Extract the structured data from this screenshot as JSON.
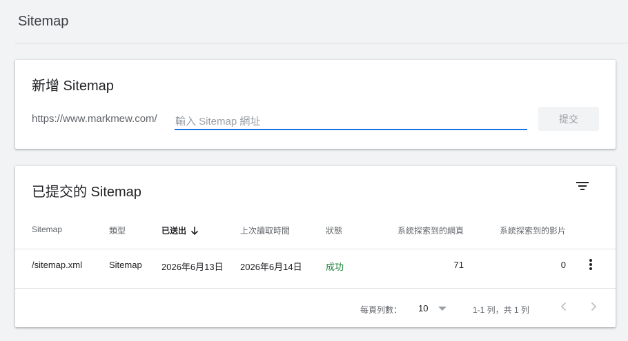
{
  "header": {
    "title": "Sitemap"
  },
  "add_card": {
    "title": "新增 Sitemap",
    "url_prefix": "https://www.markmew.com/",
    "input_placeholder": "輸入 Sitemap 網址",
    "input_value": "",
    "submit_label": "提交"
  },
  "list_card": {
    "title": "已提交的 Sitemap",
    "columns": [
      "Sitemap",
      "類型",
      "已送出",
      "上次讀取時間",
      "狀態",
      "系統探索到的網頁",
      "系統探索到的影片"
    ],
    "rows": [
      {
        "sitemap": "/sitemap.xml",
        "type": "Sitemap",
        "submitted": "2026年6月13日",
        "last_read": "2026年6月14日",
        "status": "成功",
        "pages": "71",
        "videos": "0"
      }
    ],
    "footer": {
      "rows_per_page_label": "每頁列數：",
      "rows_per_page_value": "10",
      "range_text": "1-1 列，共 1 列"
    }
  },
  "colors": {
    "accent": "#1a73e8",
    "success": "#188038",
    "text_secondary": "#5f6368"
  },
  "icons": [
    "filter-icon",
    "arrow-down-icon",
    "more-vert-icon",
    "dropdown-arrow-icon",
    "chevron-left-icon",
    "chevron-right-icon"
  ]
}
